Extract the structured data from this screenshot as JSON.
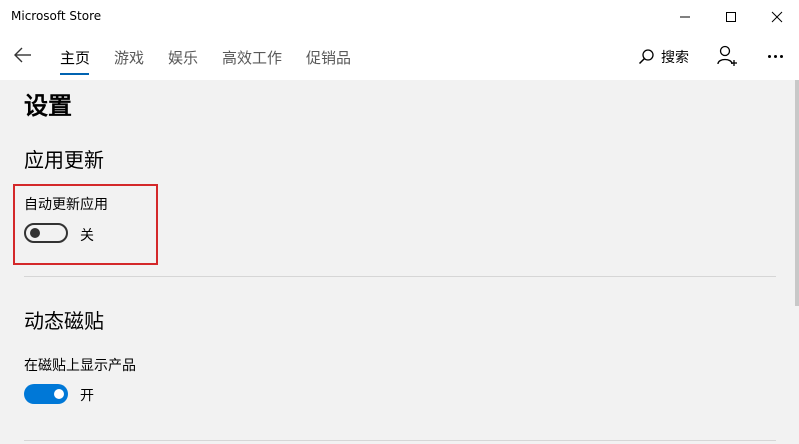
{
  "window": {
    "title": "Microsoft Store",
    "controls": [
      "minimize-icon",
      "maximize-icon",
      "close-icon"
    ]
  },
  "nav": {
    "back_icon": "back-arrow-icon",
    "tabs": [
      {
        "label": "主页",
        "active": true
      },
      {
        "label": "游戏",
        "active": false
      },
      {
        "label": "娱乐",
        "active": false
      },
      {
        "label": "高效工作",
        "active": false
      },
      {
        "label": "促销品",
        "active": false
      }
    ],
    "search_label": "搜索",
    "search_icon": "search-icon",
    "account_icon": "add-account-icon",
    "more_icon": "more-icon",
    "accent_color": "#0063b1"
  },
  "settings": {
    "page_title": "设置",
    "app_updates": {
      "heading": "应用更新",
      "label": "自动更新应用",
      "state": "关",
      "on": false
    },
    "live_tiles": {
      "heading": "动态磁贴",
      "label": "在磁贴上显示产品",
      "state": "开",
      "on": true
    },
    "toggle_on_color": "#0078d7",
    "highlight_color": "#d4282a"
  }
}
